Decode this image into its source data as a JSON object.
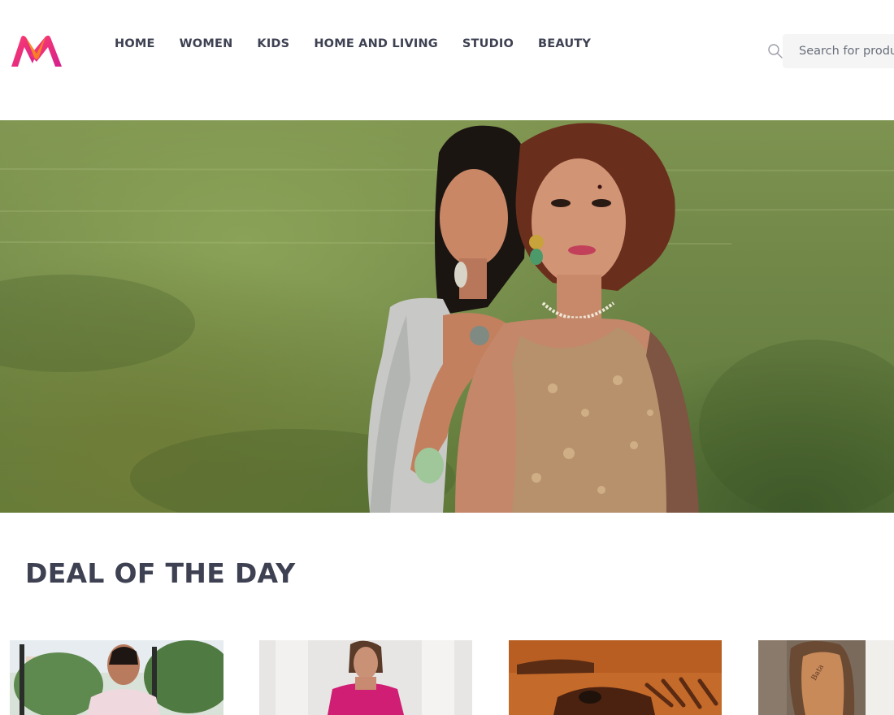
{
  "brand": {
    "name": "Myntra",
    "colors": {
      "pink": "#ff3f6c",
      "orange": "#f97f2d",
      "purple": "#d41f8f"
    }
  },
  "nav": {
    "items": [
      {
        "label": "HOME"
      },
      {
        "label": "WOMEN"
      },
      {
        "label": "KIDS"
      },
      {
        "label": "HOME AND LIVING"
      },
      {
        "label": "STUDIO"
      },
      {
        "label": "BEAUTY"
      }
    ]
  },
  "search": {
    "placeholder": "Search for products, brands and more",
    "icon": "search-icon"
  },
  "hero": {
    "icon": "hero-banner-image"
  },
  "deals": {
    "title": "DEAL OF THE DAY",
    "cards": [
      {
        "icon": "deal-product-image-ethnic-kurta"
      },
      {
        "icon": "deal-product-image-pink-dress"
      },
      {
        "icon": "deal-product-image-brown-shoes"
      },
      {
        "icon": "deal-product-image-brown-loafers"
      }
    ]
  }
}
